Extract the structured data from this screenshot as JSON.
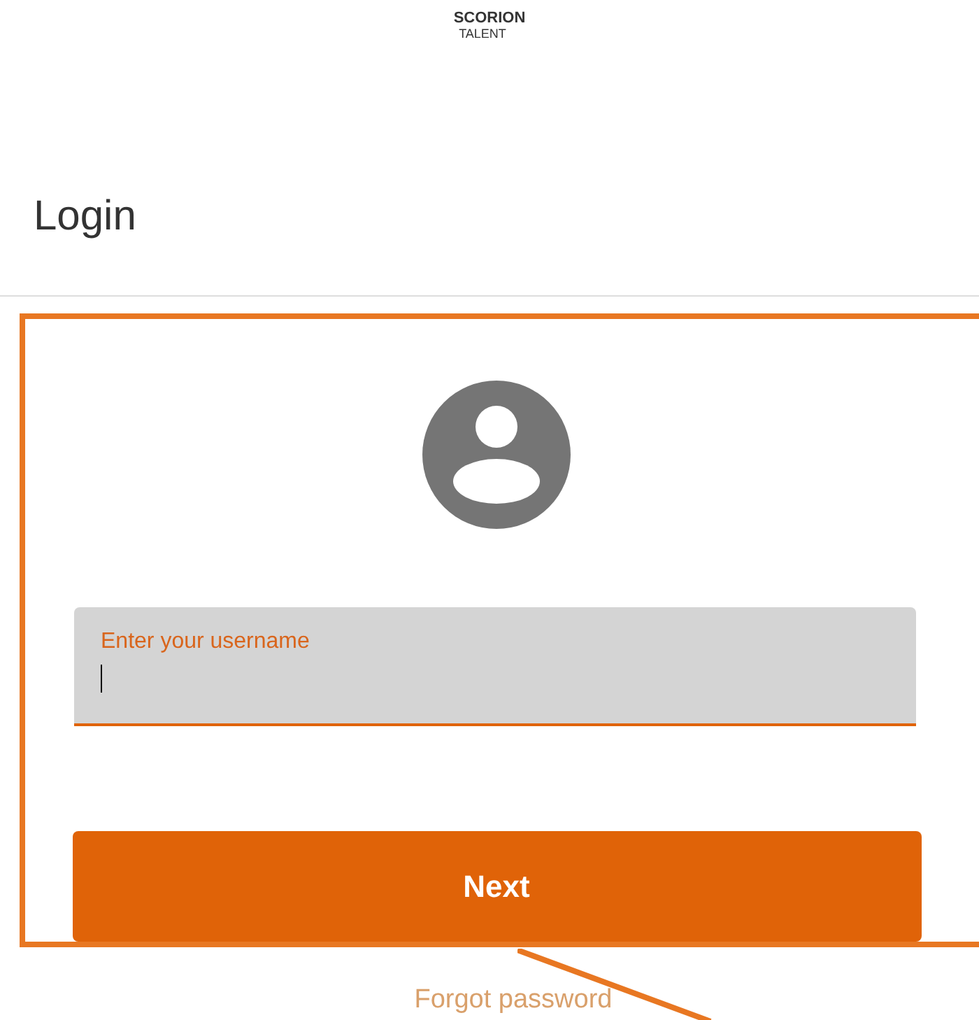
{
  "logo": {
    "line_1": "SCORION",
    "line_2": "TALENT"
  },
  "heading": "Login",
  "username_field": {
    "placeholder": "Enter your username",
    "focused": true
  },
  "next_button": "Next",
  "forgot_password_link": "Forgot password"
}
